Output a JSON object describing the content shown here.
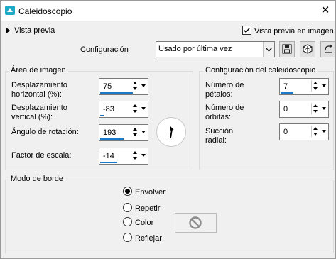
{
  "window": {
    "title": "Caleidoscopio",
    "close_glyph": "✕"
  },
  "preview": {
    "label": "Vista previa",
    "checkbox_label": "Vista previa en imagen",
    "checked": true
  },
  "config": {
    "label": "Configuración",
    "selected": "Usado por última vez"
  },
  "image_area": {
    "title": "Área de imagen",
    "fields": [
      {
        "label_line1": "Desplazamiento",
        "label_line2": "horizontal (%):",
        "value": "75",
        "level": 0.72
      },
      {
        "label_line1": "Desplazamiento",
        "label_line2": "vertical (%):",
        "value": "-83",
        "level": 0.08
      },
      {
        "label_line1": "Ángulo de rotación:",
        "label_line2": "",
        "value": "193",
        "level": 0.52
      },
      {
        "label_line1": "Factor de escala:",
        "label_line2": "",
        "value": "-14",
        "level": 0.38
      }
    ]
  },
  "kaleidoscope": {
    "title": "Configuración del caleidoscopio",
    "fields": [
      {
        "label_line1": "Número de",
        "label_line2": "pétalos:",
        "value": "7",
        "level": 0.28
      },
      {
        "label_line1": "Número de",
        "label_line2": "órbitas:",
        "value": "0",
        "level": 0.0
      },
      {
        "label_line1": "Succión",
        "label_line2": "radial:",
        "value": "0",
        "level": 0.0
      }
    ]
  },
  "edge_mode": {
    "title": "Modo de borde",
    "options": [
      "Envolver",
      "Repetir",
      "Color",
      "Reflejar"
    ],
    "selected": "Envolver"
  },
  "icons": [
    "kaleidoscope-app-icon",
    "save-icon",
    "dice-icon",
    "reset-icon",
    "no-color-icon",
    "dial-pointer-icon"
  ],
  "colors": {
    "accent": "#1979ca",
    "window_bg": "#f0f0f0"
  }
}
